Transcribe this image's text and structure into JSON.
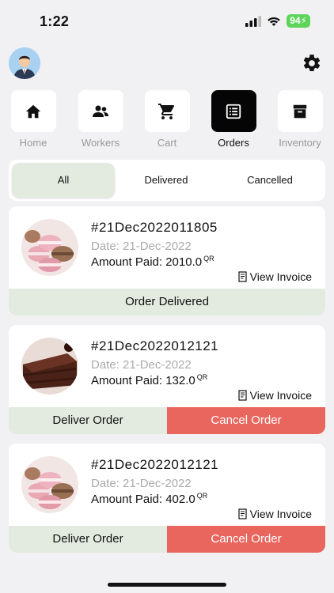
{
  "status": {
    "time": "1:22",
    "battery": "94"
  },
  "nav": {
    "tabs": [
      {
        "label": "Home",
        "icon": "home-icon"
      },
      {
        "label": "Workers",
        "icon": "people-icon"
      },
      {
        "label": "Cart",
        "icon": "cart-icon"
      },
      {
        "label": "Orders",
        "icon": "orders-icon",
        "active": true
      },
      {
        "label": "Inventory",
        "icon": "archive-icon"
      }
    ]
  },
  "filters": [
    {
      "label": "All",
      "active": true
    },
    {
      "label": "Delivered"
    },
    {
      "label": "Cancelled"
    }
  ],
  "orders": [
    {
      "id": "#21Dec2022011805",
      "date": "Date: 21-Dec-2022",
      "amount_label": "Amount Paid: 2010.0",
      "currency": "QR",
      "invoice": "View Invoice",
      "image": "macarons",
      "status_label": "Order Delivered"
    },
    {
      "id": "#21Dec2022012121",
      "date": "Date: 21-Dec-2022",
      "amount_label": "Amount Paid: 132.0",
      "currency": "QR",
      "invoice": "View Invoice",
      "image": "chocolate-cake",
      "deliver_label": "Deliver Order",
      "cancel_label": "Cancel Order"
    },
    {
      "id": "#21Dec2022012121",
      "date": "Date: 21-Dec-2022",
      "amount_label": "Amount Paid: 402.0",
      "currency": "QR",
      "invoice": "View Invoice",
      "image": "macarons",
      "deliver_label": "Deliver Order",
      "cancel_label": "Cancel Order"
    }
  ],
  "colors": {
    "accent_green": "#e3ebe0",
    "cancel_red": "#e8665e",
    "active_tab": "#050505"
  }
}
